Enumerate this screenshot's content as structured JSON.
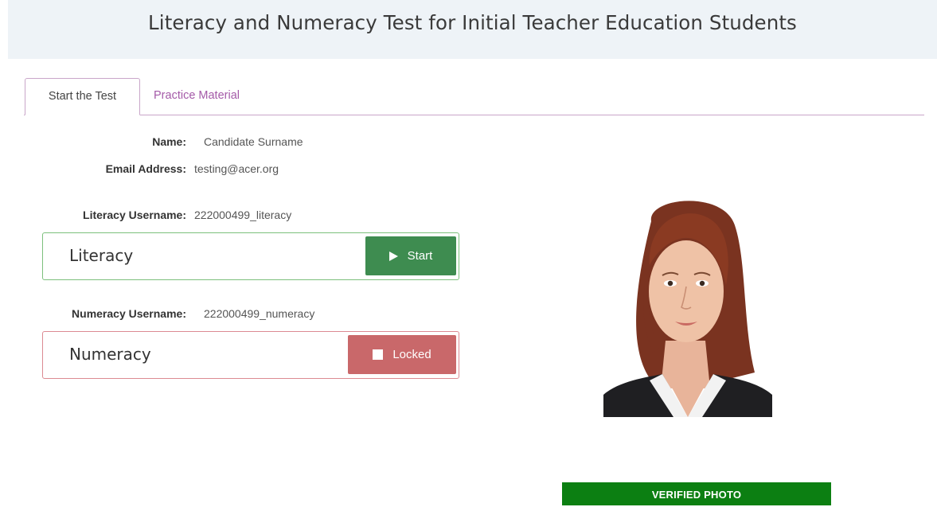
{
  "header": {
    "title": "Literacy and Numeracy Test for Initial Teacher Education Students"
  },
  "tabs": [
    {
      "label": "Start the Test",
      "active": true
    },
    {
      "label": "Practice Material",
      "active": false
    }
  ],
  "candidate": {
    "name_label": "Name:",
    "name_value": "Candidate Surname",
    "email_label": "Email Address:",
    "email_value": "testing@acer.org"
  },
  "literacy": {
    "username_label": "Literacy Username:",
    "username_value": "222000499_literacy",
    "test_name": "Literacy",
    "button_label": "Start",
    "button_icon": "play-icon",
    "color": "#3e8c50"
  },
  "numeracy": {
    "username_label": "Numeracy Username:",
    "username_value": "222000499_numeracy",
    "test_name": "Numeracy",
    "button_label": "Locked",
    "button_icon": "stop-icon",
    "color": "#c9686a"
  },
  "photo": {
    "verified_label": "VERIFIED PHOTO",
    "verified_color": "#0c7f12"
  }
}
